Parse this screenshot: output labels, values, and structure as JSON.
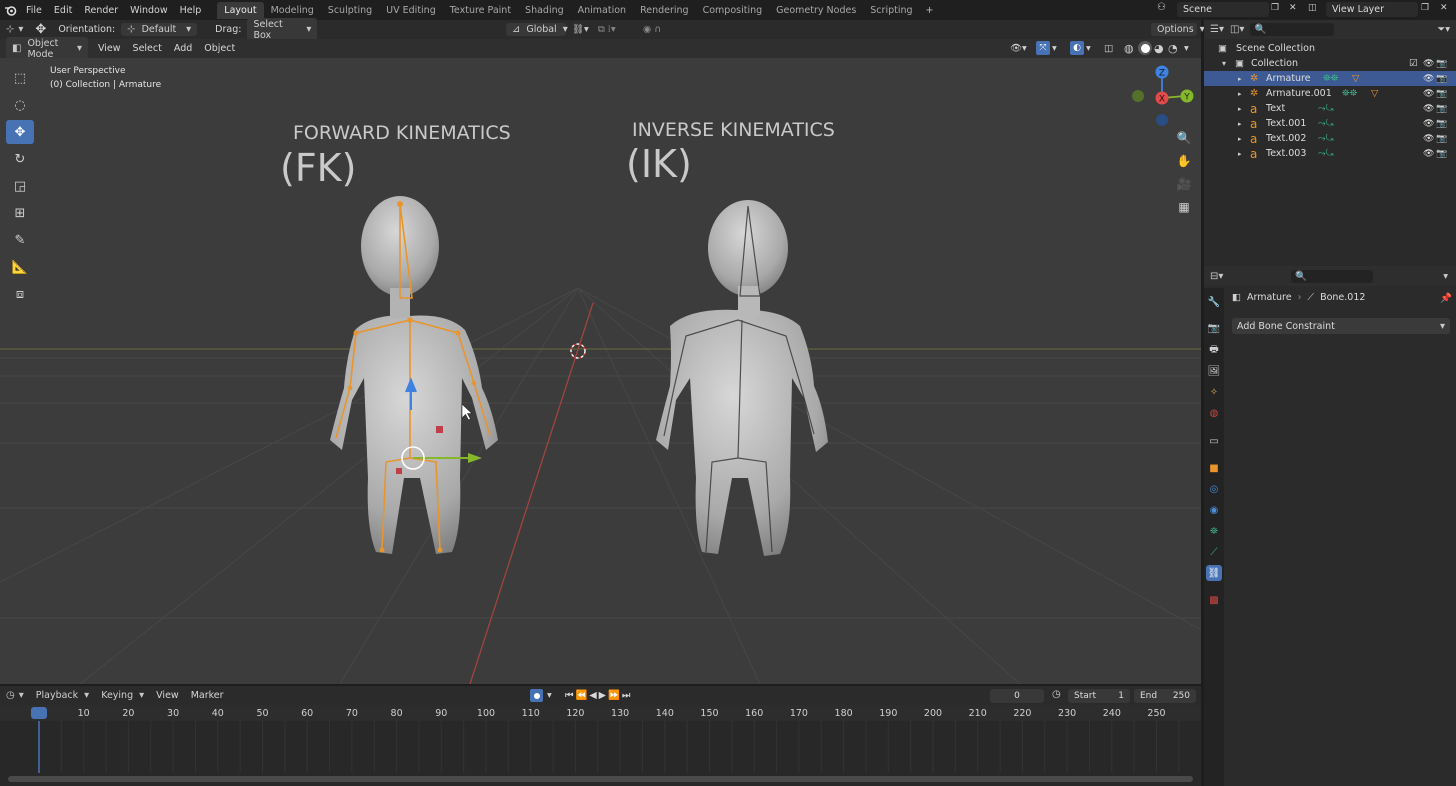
{
  "topbar": {
    "menus": [
      "File",
      "Edit",
      "Render",
      "Window",
      "Help"
    ],
    "workspaces": [
      "Layout",
      "Modeling",
      "Sculpting",
      "UV Editing",
      "Texture Paint",
      "Shading",
      "Animation",
      "Rendering",
      "Compositing",
      "Geometry Nodes",
      "Scripting"
    ],
    "scene": "Scene",
    "view_layer": "View Layer"
  },
  "header1": {
    "orientation_label": "Orientation:",
    "orientation_value": "Default",
    "drag_label": "Drag:",
    "drag_value": "Select Box",
    "transform_value": "Global",
    "options": "Options"
  },
  "header2": {
    "mode": "Object Mode",
    "menus": [
      "View",
      "Select",
      "Add",
      "Object"
    ]
  },
  "viewport": {
    "perspective": "User Perspective",
    "collection_info": "(0) Collection | Armature",
    "fk_title": "FORWARD KINEMATICS",
    "fk_abbr": "(FK)",
    "ik_title": "INVERSE KINEMATICS",
    "ik_abbr": "(IK)",
    "gizmo_axes": [
      "Z",
      "X",
      "Y"
    ]
  },
  "timeline": {
    "menus": [
      "Playback",
      "Keying",
      "View",
      "Marker"
    ],
    "current_frame": "0",
    "start_label": "Start",
    "start_value": "1",
    "end_label": "End",
    "end_value": "250",
    "ticks": [
      "0",
      "10",
      "20",
      "30",
      "40",
      "50",
      "60",
      "70",
      "80",
      "90",
      "100",
      "110",
      "120",
      "130",
      "140",
      "150",
      "160",
      "170",
      "180",
      "190",
      "200",
      "210",
      "220",
      "230",
      "240",
      "250"
    ]
  },
  "outliner": {
    "scene_collection": "Scene Collection",
    "collection": "Collection",
    "items": [
      {
        "label": "Armature",
        "selected": true,
        "icon": "armature-icon"
      },
      {
        "label": "Armature.001",
        "selected": false,
        "icon": "armature-icon"
      },
      {
        "label": "Text",
        "selected": false,
        "icon": "text-icon"
      },
      {
        "label": "Text.001",
        "selected": false,
        "icon": "text-icon"
      },
      {
        "label": "Text.002",
        "selected": false,
        "icon": "text-icon"
      },
      {
        "label": "Text.003",
        "selected": false,
        "icon": "text-icon"
      }
    ]
  },
  "properties": {
    "breadcrumb_object": "Armature",
    "breadcrumb_bone": "Bone.012",
    "add_constraint": "Add Bone Constraint"
  },
  "colors": {
    "accent": "#4772b3",
    "bone_orange": "#e8952e",
    "axis_x": "#e34a4a",
    "axis_y": "#86b82c",
    "axis_z": "#3f82e0"
  }
}
